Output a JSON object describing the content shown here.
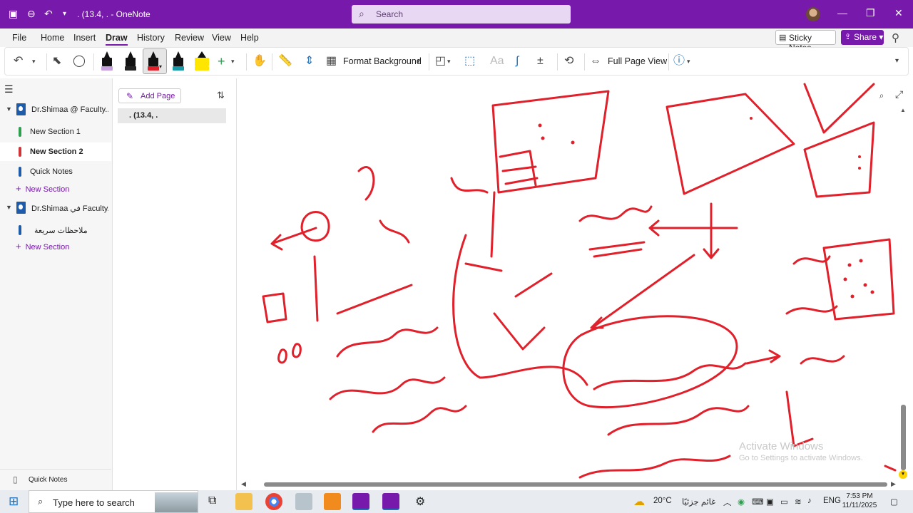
{
  "titlebar": {
    "title": ". (13.4, .  -  OneNote",
    "search_placeholder": "Search"
  },
  "menu": {
    "items": [
      "File",
      "Home",
      "Insert",
      "Draw",
      "History",
      "Review",
      "View",
      "Help"
    ],
    "active": "Draw",
    "sticky_notes": "Sticky Notes",
    "share": "Share"
  },
  "ribbon": {
    "format_background": "Format Background",
    "full_page_view": "Full Page View"
  },
  "notebooks": [
    {
      "name": "Dr.Shimaa @ Faculty...",
      "sections": [
        "New Section 1",
        "New Section 2",
        "Quick Notes"
      ],
      "active_section": "New Section 2",
      "add_section": "New Section"
    },
    {
      "name": "Dr.Shimaa في Faculty...",
      "sections": [
        "ملاحظات سريعة"
      ],
      "add_section": "New Section"
    }
  ],
  "section_colors": [
    "#2e9e4f",
    "#d13438",
    "#1e5ba8",
    "#1e5ba8"
  ],
  "quick_notes_footer": "Quick Notes",
  "pages": {
    "add_page": "Add Page",
    "items": [
      ". (13.4, ."
    ]
  },
  "ink": {
    "color": "#e0202a"
  },
  "watermark": {
    "line1": "Activate Windows",
    "line2": "Go to Settings to activate Windows."
  },
  "taskbar": {
    "search_placeholder": "Type here to search",
    "weather_temp": "20°C",
    "weather_text": "غائم جزئيًا",
    "language": "ENG",
    "time": "7:53 PM",
    "date": "11/11/2025"
  }
}
